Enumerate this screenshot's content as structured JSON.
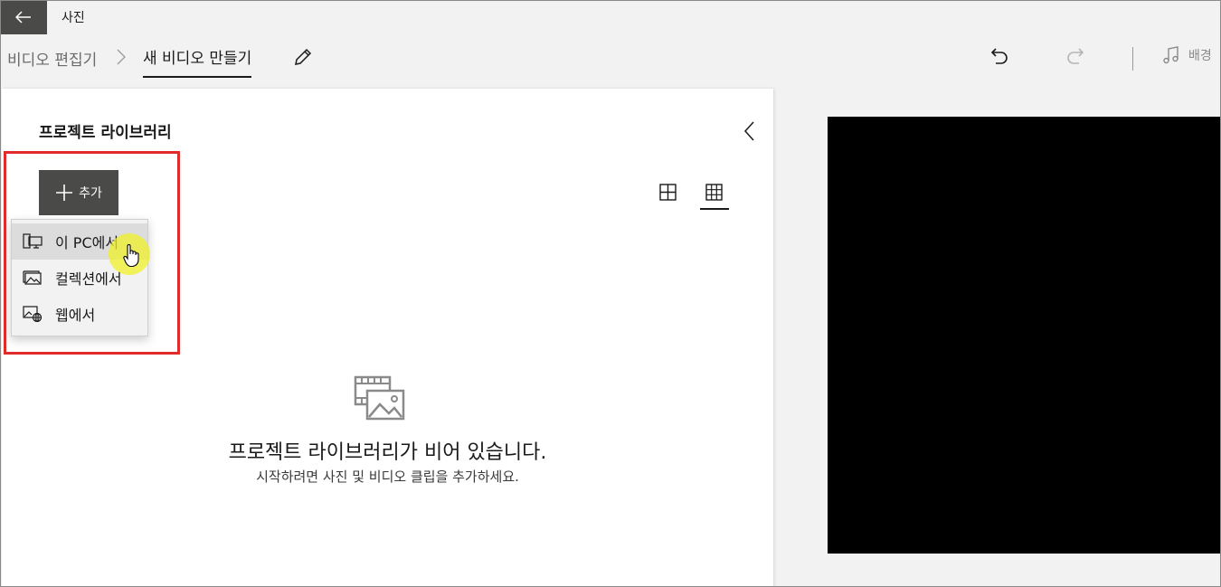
{
  "app": {
    "title": "사진",
    "back_icon": "arrow-left-icon"
  },
  "breadcrumb": {
    "root": "비디오 편집기",
    "current": "새 비디오 만들기"
  },
  "toolbar": {
    "music_label": "배경"
  },
  "library": {
    "title": "프로젝트 라이브러리",
    "add_label": "추가",
    "menu": [
      {
        "label": "이 PC에서",
        "icon": "computer-icon"
      },
      {
        "label": "컬렉션에서",
        "icon": "photo-collection-icon"
      },
      {
        "label": "웹에서",
        "icon": "web-image-icon"
      }
    ],
    "empty_title": "프로젝트 라이브러리가 비어 있습니다.",
    "empty_subtitle": "시작하려면 사진 및 비디오 클립을 추가하세요."
  },
  "colors": {
    "accent_dark": "#4a4a48",
    "highlight_border": "#e02b2b",
    "cursor_highlight": "#f0f028",
    "preview_bg": "#000000"
  }
}
